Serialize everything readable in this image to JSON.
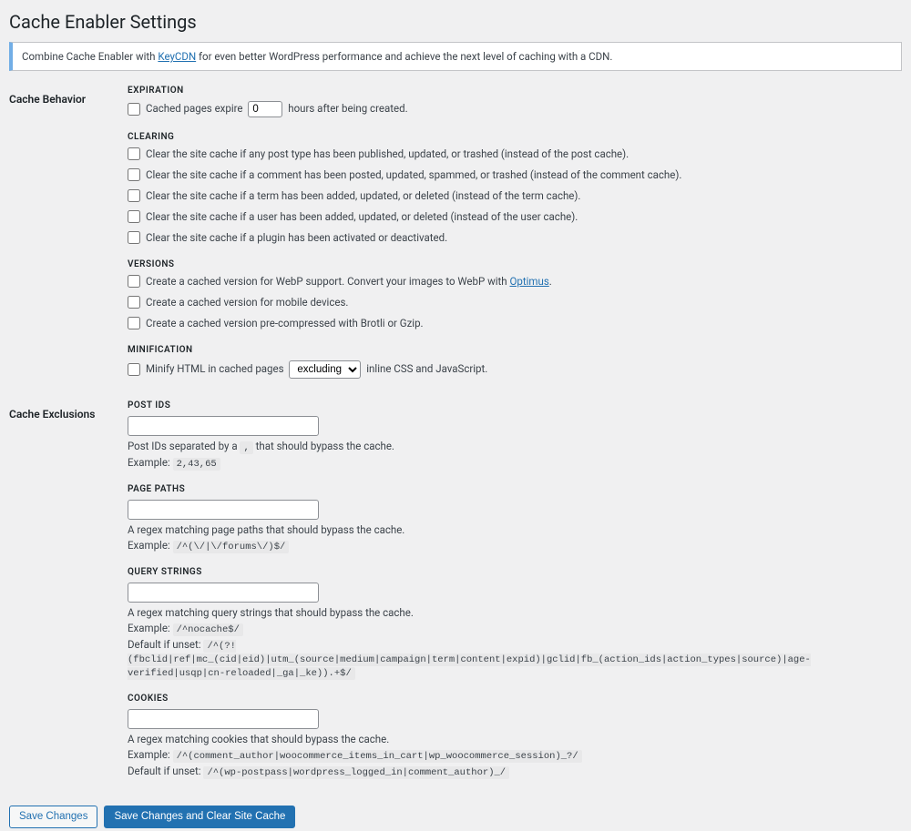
{
  "page": {
    "title": "Cache Enabler Settings"
  },
  "notice": {
    "pre": "Combine Cache Enabler with ",
    "link": "KeyCDN",
    "post": " for even better WordPress performance and achieve the next level of caching with a CDN."
  },
  "sections": {
    "behavior": {
      "heading": "Cache Behavior",
      "expiration": {
        "subtitle": "EXPIRATION",
        "label_pre": "Cached pages expire",
        "hours_value": "0",
        "label_post": "hours after being created."
      },
      "clearing": {
        "subtitle": "CLEARING",
        "items": [
          "Clear the site cache if any post type has been published, updated, or trashed (instead of the post cache).",
          "Clear the site cache if a comment has been posted, updated, spammed, or trashed (instead of the comment cache).",
          "Clear the site cache if a term has been added, updated, or deleted (instead of the term cache).",
          "Clear the site cache if a user has been added, updated, or deleted (instead of the user cache).",
          "Clear the site cache if a plugin has been activated or deactivated."
        ]
      },
      "versions": {
        "subtitle": "VERSIONS",
        "webp_pre": "Create a cached version for WebP support. Convert your images to WebP with ",
        "webp_link": "Optimus",
        "webp_post": ".",
        "mobile": "Create a cached version for mobile devices.",
        "compress": "Create a cached version pre-compressed with Brotli or Gzip."
      },
      "minification": {
        "subtitle": "MINIFICATION",
        "label_pre": "Minify HTML in cached pages",
        "select_value": "excluding",
        "label_post": "inline CSS and JavaScript."
      }
    },
    "exclusions": {
      "heading": "Cache Exclusions",
      "post_ids": {
        "subtitle": "POST IDS",
        "desc_pre": "Post IDs separated by a ",
        "desc_sep": ",",
        "desc_post": " that should bypass the cache.",
        "example_label": "Example:",
        "example": "2,43,65"
      },
      "page_paths": {
        "subtitle": "PAGE PATHS",
        "desc": "A regex matching page paths that should bypass the cache.",
        "example_label": "Example:",
        "example": "/^(\\/|\\/forums\\/)$/"
      },
      "query_strings": {
        "subtitle": "QUERY STRINGS",
        "desc": "A regex matching query strings that should bypass the cache.",
        "example_label": "Example:",
        "example": "/^nocache$/",
        "default_label": "Default if unset:",
        "default": "/^(?!(fbclid|ref|mc_(cid|eid)|utm_(source|medium|campaign|term|content|expid)|gclid|fb_(action_ids|action_types|source)|age-verified|usqp|cn-reloaded|_ga|_ke)).+$/"
      },
      "cookies": {
        "subtitle": "COOKIES",
        "desc": "A regex matching cookies that should bypass the cache.",
        "example_label": "Example:",
        "example": "/^(comment_author|woocommerce_items_in_cart|wp_woocommerce_session)_?/",
        "default_label": "Default if unset:",
        "default": "/^(wp-postpass|wordpress_logged_in|comment_author)_/"
      }
    }
  },
  "buttons": {
    "save": "Save Changes",
    "save_clear": "Save Changes and Clear Site Cache"
  }
}
